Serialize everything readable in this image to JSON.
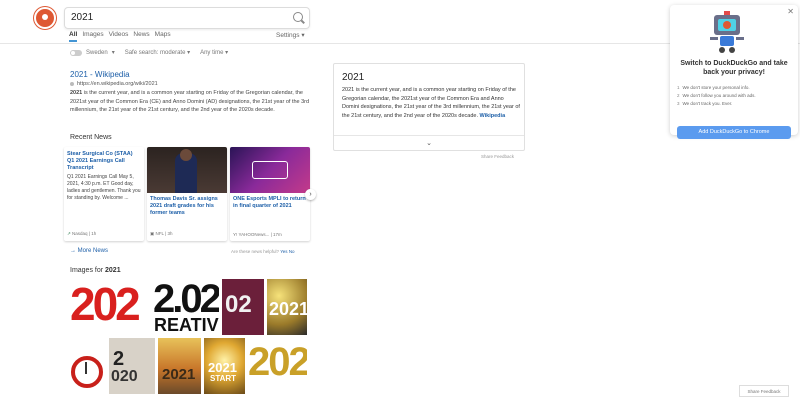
{
  "search": {
    "query": "2021"
  },
  "tabs": [
    "All",
    "Images",
    "Videos",
    "News",
    "Maps"
  ],
  "settings_label": "Settings",
  "filters": {
    "region": "Sweden",
    "safe_search": "Safe search: moderate",
    "time": "Any time"
  },
  "result": {
    "title": "2021 - Wikipedia",
    "url": "https://en.wikipedia.org/wiki/2021",
    "snippet_pre": "",
    "snippet_bold": "2021",
    "snippet_post": " is the current year, and is a common year starting on Friday of the Gregorian calendar, the 2021st year of the Common Era (CE) and Anno Domini (AD) designations, the 21st year of the 3rd millennium, the 21st year of the 21st century, and the 2nd year of the 2020s decade."
  },
  "recent_news_heading": "Recent News",
  "news": [
    {
      "title": "Stear Surgical Co (STAA) Q1 2021 Earnings Call Transcript",
      "body": "Q1 2021 Earnings Call May 5, 2021, 4:30 p.m. ET Good day, ladies and gentlemen. Thank you for standing by. Welcome ...",
      "source": "Nasdaq",
      "age": "1h",
      "bg": "#ffffff"
    },
    {
      "title": "Thomas Davis Sr. assigns 2021 draft grades for his former teams",
      "body": "",
      "source": "NFL",
      "age": "3h",
      "bg": "#3a2a25"
    },
    {
      "title": "ONE Esports MPLI to return in final quarter of 2021",
      "body": "",
      "source": "YAHOONews...",
      "age": "17m",
      "bg": "#5a2a8a"
    }
  ],
  "more_news": "More News",
  "helpful": "Are these news helpful?",
  "helpful_yes": "Yes",
  "helpful_no": "No",
  "images_heading": "Images for 2021",
  "images_heading_bold": "2021",
  "infobox": {
    "title": "2021",
    "body": "2021 is the current year, and is a common year starting on Friday of the Gregorian calendar, the 2021st year of the Common Era and Anno Domini designations, the 21st year of the 3rd millennium, the 21st year of the 21st century, and the 2nd year of the 2020s decade.",
    "link": "Wikipedia"
  },
  "share_feedback": "Share Feedback",
  "popup": {
    "heading": "Switch to DuckDuckGo and take back your privacy!",
    "items": [
      "We don't store your personal info.",
      "We don't follow you around with ads.",
      "We don't track you. Ever."
    ],
    "cta": "Add DuckDuckGo to Chrome"
  },
  "bottom_feedback": "Share Feedback",
  "colors": {
    "accent": "#4495d4",
    "link": "#1d5fa8",
    "brand": "#de5833",
    "cta": "#5b9bef"
  }
}
